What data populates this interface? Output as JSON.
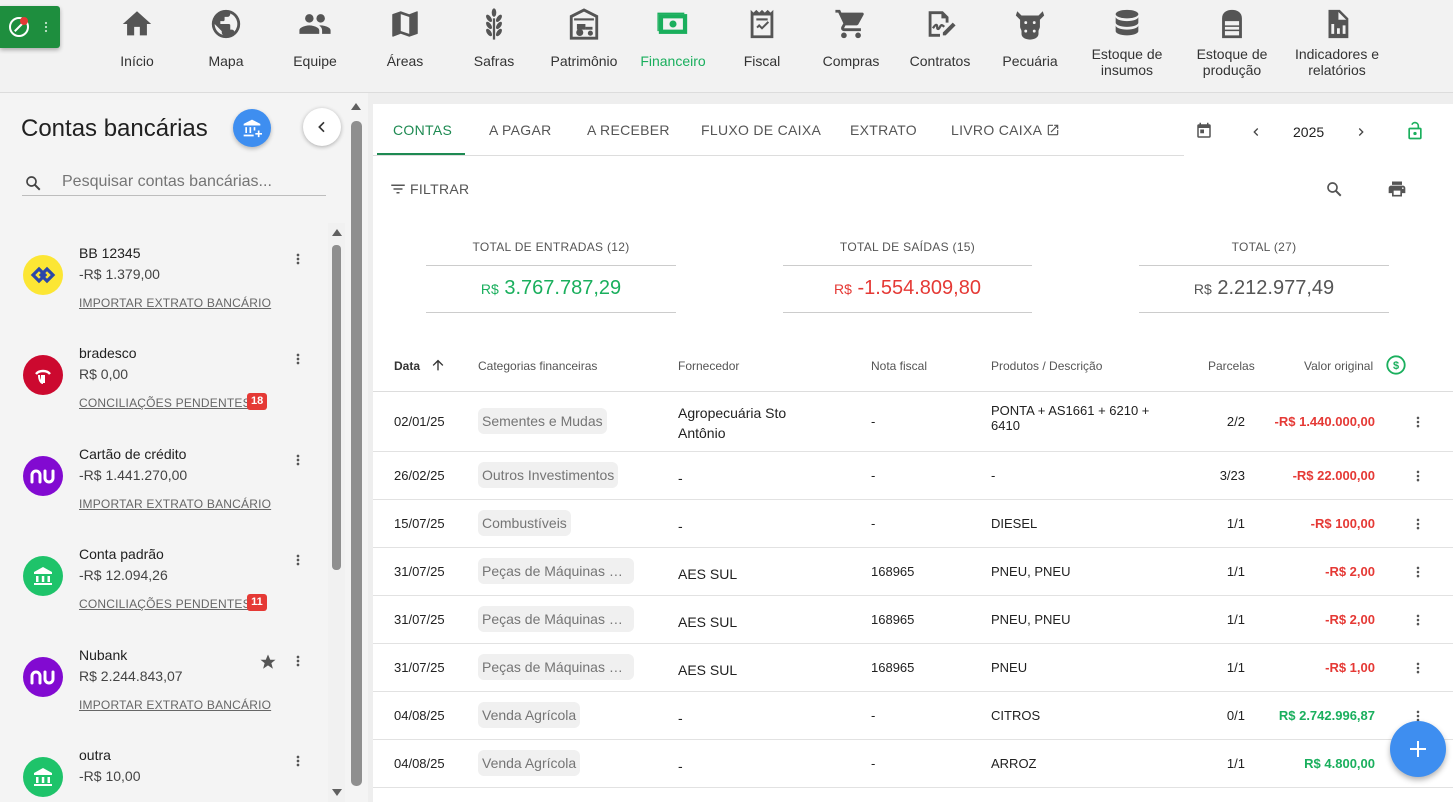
{
  "nav": {
    "items": [
      {
        "label": "Início",
        "icon": "home-icon"
      },
      {
        "label": "Mapa",
        "icon": "globe-icon"
      },
      {
        "label": "Equipe",
        "icon": "people-icon"
      },
      {
        "label": "Áreas",
        "icon": "map-fold-icon"
      },
      {
        "label": "Safras",
        "icon": "wheat-icon"
      },
      {
        "label": "Patrimônio",
        "icon": "tractor-barn-icon"
      },
      {
        "label": "Financeiro",
        "icon": "money-icon",
        "active": true
      },
      {
        "label": "Fiscal",
        "icon": "invoice-icon"
      },
      {
        "label": "Compras",
        "icon": "cart-icon"
      },
      {
        "label": "Contratos",
        "icon": "contract-sign-icon"
      },
      {
        "label": "Pecuária",
        "icon": "cow-icon"
      },
      {
        "label": "Estoque de insumos",
        "icon": "database-icon"
      },
      {
        "label": "Estoque de produção",
        "icon": "silo-icon"
      },
      {
        "label": "Indicadores e relatórios",
        "icon": "report-icon"
      }
    ]
  },
  "sidebar": {
    "title": "Contas bancárias",
    "search_placeholder": "Pesquisar contas bancárias...",
    "accounts": [
      {
        "name": "BB 12345",
        "balance": "-R$ 1.379,00",
        "action": "IMPORTAR EXTRATO BANCÁRIO",
        "logo": "bb",
        "badge": null,
        "favorite": false
      },
      {
        "name": "bradesco",
        "balance": "R$ 0,00",
        "action": "CONCILIAÇÕES PENDENTES",
        "logo": "bradesco",
        "badge": "18",
        "favorite": false
      },
      {
        "name": "Cartão de crédito",
        "balance": "-R$ 1.441.270,00",
        "action": "IMPORTAR EXTRATO BANCÁRIO",
        "logo": "nu",
        "badge": null,
        "favorite": false
      },
      {
        "name": "Conta padrão",
        "balance": "-R$ 12.094,26",
        "action": "CONCILIAÇÕES PENDENTES",
        "logo": "bank",
        "badge": "11",
        "favorite": false
      },
      {
        "name": "Nubank",
        "balance": "R$ 2.244.843,07",
        "action": "IMPORTAR EXTRATO BANCÁRIO",
        "logo": "nu",
        "badge": null,
        "favorite": true
      },
      {
        "name": "outra",
        "balance": "-R$ 10,00",
        "action": "",
        "logo": "bank",
        "badge": null,
        "favorite": false
      }
    ]
  },
  "tabs": [
    "CONTAS",
    "A PAGAR",
    "A RECEBER",
    "FLUXO DE CAIXA",
    "EXTRATO",
    "LIVRO CAIXA"
  ],
  "year": "2025",
  "filter_label": "FILTRAR",
  "totals": {
    "entradas": {
      "label": "TOTAL DE ENTRADAS (12)",
      "currency": "R$",
      "value": "3.767.787,29",
      "color": "#1aaf5d"
    },
    "saidas": {
      "label": "TOTAL DE SAÍDAS (15)",
      "currency": "R$",
      "value": "-1.554.809,80",
      "color": "#e53935"
    },
    "total": {
      "label": "TOTAL (27)",
      "currency": "R$",
      "value": "2.212.977,49",
      "color": "#555555"
    }
  },
  "table": {
    "columns": [
      "Data",
      "Categorias financeiras",
      "Fornecedor",
      "Nota fiscal",
      "Produtos / Descrição",
      "Parcelas",
      "Valor original"
    ],
    "rows": [
      {
        "date": "02/01/25",
        "category": "Sementes e Mudas",
        "supplier": "Agropecuária Sto Antônio",
        "invoice": "-",
        "product": "PONTA + AS1661 + 6210 + 6410",
        "installments": "2/2",
        "value": "-R$ 1.440.000,00",
        "type": "neg"
      },
      {
        "date": "26/02/25",
        "category": "Outros Investimentos",
        "supplier": "-",
        "invoice": "-",
        "product": "-",
        "installments": "3/23",
        "value": "-R$ 22.000,00",
        "type": "neg"
      },
      {
        "date": "15/07/25",
        "category": "Combustíveis",
        "supplier": "-",
        "invoice": "-",
        "product": "DIESEL",
        "installments": "1/1",
        "value": "-R$ 100,00",
        "type": "neg"
      },
      {
        "date": "31/07/25",
        "category": "Peças de Máquinas e ...",
        "supplier": "AES SUL",
        "invoice": "168965",
        "product": "PNEU, PNEU",
        "installments": "1/1",
        "value": "-R$ 2,00",
        "type": "neg"
      },
      {
        "date": "31/07/25",
        "category": "Peças de Máquinas e ...",
        "supplier": "AES SUL",
        "invoice": "168965",
        "product": "PNEU, PNEU",
        "installments": "1/1",
        "value": "-R$ 2,00",
        "type": "neg"
      },
      {
        "date": "31/07/25",
        "category": "Peças de Máquinas e ...",
        "supplier": "AES SUL",
        "invoice": "168965",
        "product": "PNEU",
        "installments": "1/1",
        "value": "-R$ 1,00",
        "type": "neg"
      },
      {
        "date": "04/08/25",
        "category": "Venda Agrícola",
        "supplier": "-",
        "invoice": "-",
        "product": "CITROS",
        "installments": "0/1",
        "value": "R$ 2.742.996,87",
        "type": "pos"
      },
      {
        "date": "04/08/25",
        "category": "Venda Agrícola",
        "supplier": "-",
        "invoice": "-",
        "product": "ARROZ",
        "installments": "1/1",
        "value": "R$ 4.800,00",
        "type": "pos"
      }
    ]
  }
}
